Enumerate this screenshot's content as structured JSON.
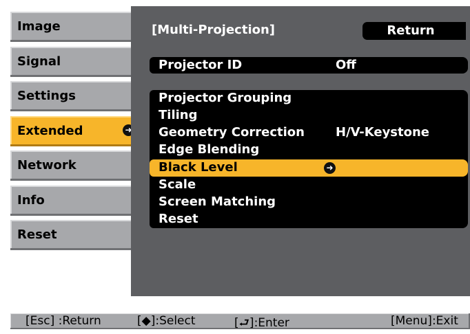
{
  "tabs": [
    {
      "label": "Image",
      "active": false
    },
    {
      "label": "Signal",
      "active": false
    },
    {
      "label": "Settings",
      "active": false
    },
    {
      "label": "Extended",
      "active": true
    },
    {
      "label": "Network",
      "active": false
    },
    {
      "label": "Info",
      "active": false
    },
    {
      "label": "Reset",
      "active": false
    }
  ],
  "enter_icon_glyph": "⮐",
  "panel": {
    "title": "[Multi-Projection]",
    "return_label": "Return",
    "projector_id": {
      "label": "Projector ID",
      "value": "Off"
    },
    "items": [
      {
        "label": "Projector Grouping",
        "value": ""
      },
      {
        "label": "Tiling",
        "value": ""
      },
      {
        "label": "Geometry Correction",
        "value": "H/V-Keystone"
      },
      {
        "label": "Edge Blending",
        "value": ""
      },
      {
        "label": "Black Level",
        "value": "",
        "selected": true
      },
      {
        "label": "Scale",
        "value": ""
      },
      {
        "label": "Screen Matching",
        "value": ""
      },
      {
        "label": "Reset",
        "value": ""
      }
    ]
  },
  "footer": {
    "esc": "[Esc] :Return",
    "select": "[◆]:Select",
    "enter": "[⮐]:Enter",
    "menu": "[Menu]:Exit"
  },
  "colors": {
    "accent": "#f7b52a",
    "panel_bg": "#5d5e61",
    "tab_bg": "#a7a8ab"
  }
}
